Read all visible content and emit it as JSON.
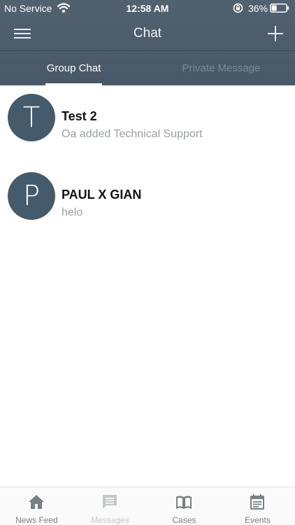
{
  "status_bar": {
    "carrier": "No Service",
    "time": "12:58 AM",
    "battery_percent": "36%",
    "battery_level": 0.36
  },
  "nav": {
    "title": "Chat",
    "menu_icon": "hamburger-menu-icon",
    "add_icon": "plus-icon"
  },
  "tabs": [
    {
      "label": "Group Chat",
      "active": true
    },
    {
      "label": "Private Message",
      "active": false
    }
  ],
  "chats": [
    {
      "initial": "T",
      "name": "Test 2",
      "preview": "Oa added Technical Support"
    },
    {
      "initial": "P",
      "name": "PAUL X GIAN",
      "preview": "helo"
    }
  ],
  "bottom_nav": [
    {
      "label": "News Feed",
      "icon": "home-icon",
      "active": true
    },
    {
      "label": "Messages",
      "icon": "message-icon",
      "active": false
    },
    {
      "label": "Cases",
      "icon": "book-icon",
      "active": true
    },
    {
      "label": "Events",
      "icon": "calendar-icon",
      "active": true
    }
  ],
  "colors": {
    "header": "#4f5e6d",
    "avatar": "#455a6b",
    "bottom_active": "#7a7f84",
    "bottom_inactive": "#c4c8cc"
  }
}
